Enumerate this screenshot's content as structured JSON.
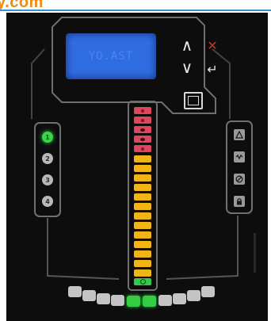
{
  "brand": {
    "text": "y.com",
    "color": "#f08a12"
  },
  "display": {
    "text": "YO.AST",
    "color": "#2f6de2"
  },
  "nav": {
    "up": "∧",
    "down": "∨",
    "cancel": "✕",
    "enter": "↵",
    "cancel_color": "#c0392b"
  },
  "channels": [
    {
      "label": "1",
      "on": true
    },
    {
      "label": "2",
      "on": false
    },
    {
      "label": "3",
      "on": false
    },
    {
      "label": "4",
      "on": false
    }
  ],
  "status_icons": [
    "alarm-warning-icon",
    "signal-wave-icon",
    "prohibited-icon",
    "lock-icon"
  ],
  "level_meter": {
    "segments_total": 19,
    "red_segments": 5,
    "amber_segments": 13,
    "green_segments": 1,
    "colors": {
      "red": "#e0455e",
      "amber": "#f0b414",
      "green": "#34c84a"
    }
  },
  "bottom_indicators": {
    "count": 10,
    "lit": [
      4,
      5
    ],
    "on_color": "#33cc44"
  }
}
